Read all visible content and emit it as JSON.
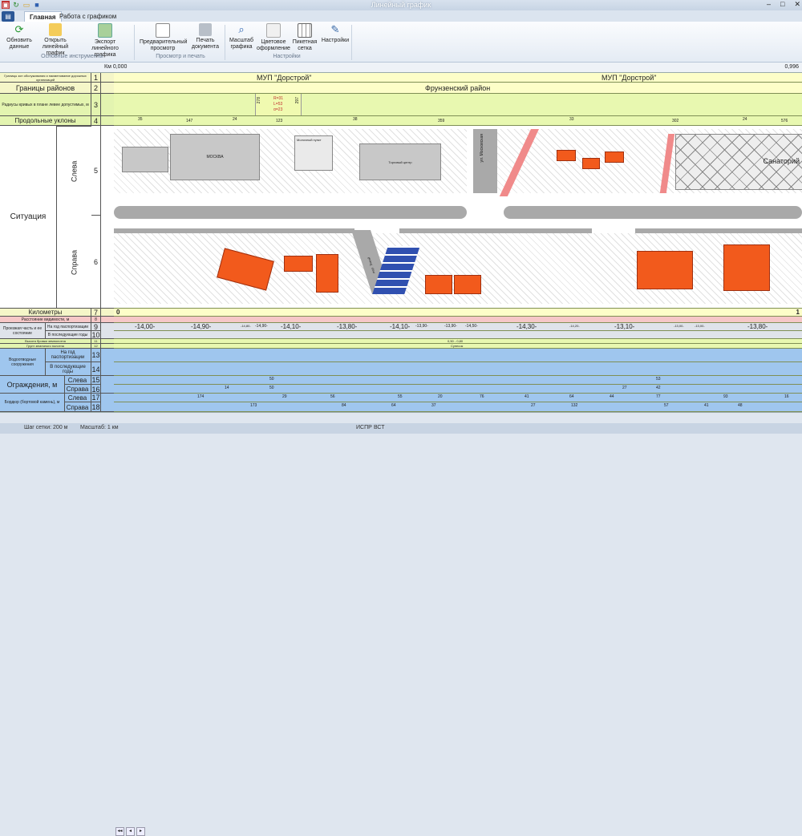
{
  "window": {
    "title": "Линейный график"
  },
  "tabs": [
    {
      "label": "Главная"
    },
    {
      "label": "Работа с графиком"
    }
  ],
  "ribbon": {
    "buttons": [
      {
        "label": "Обновить данные",
        "icon": "refresh-icon"
      },
      {
        "label": "Открыть линейный график",
        "icon": "folder-open-icon"
      },
      {
        "label": "Экспорт линейного графика",
        "icon": "export-icon"
      },
      {
        "label": "Предварительный просмотр",
        "icon": "preview-icon"
      },
      {
        "label": "Печать документа",
        "icon": "printer-icon"
      },
      {
        "label": "Масштаб графика",
        "icon": "zoom-icon"
      },
      {
        "label": "Цветовое оформление",
        "icon": "palette-icon"
      },
      {
        "label": "Пикетная сетка",
        "icon": "grid-icon"
      },
      {
        "label": "Настройки",
        "icon": "settings-icon"
      }
    ],
    "groups": [
      "Основные инструменты",
      "Просмотр и печать",
      "Настройки"
    ]
  },
  "ruler": {
    "start": "Км 0,000",
    "end": "0,996"
  },
  "rows": {
    "r1": {
      "label": "Границы зон обслуживания и наименование дорожных организаций",
      "num": "1"
    },
    "r2": {
      "label": "Границы районов",
      "num": "2"
    },
    "r3": {
      "label": "Радиусы кривых в плане левее допустимых, м",
      "num": "3"
    },
    "r4": {
      "label": "Продольные уклоны",
      "num": "4"
    },
    "situation": {
      "label": "Ситуация"
    },
    "left_side": {
      "label": "Слева",
      "num": "5"
    },
    "right_side": {
      "label": "Справа",
      "num": "6"
    },
    "r7": {
      "label": "Километры",
      "num": "7"
    },
    "r8": {
      "label": "Расстояние видимости, м",
      "num": "8"
    },
    "r9group": {
      "label": "Проезжая часть и ее состояние"
    },
    "r9": {
      "label": "На год паспортизации",
      "num": "9"
    },
    "r10": {
      "label": "В последующие годы",
      "num": "10"
    },
    "r11": {
      "label": "Высота бровки земполотна",
      "num": "11"
    },
    "r12": {
      "label": "Грунт земляного полотна",
      "num": "12"
    },
    "drain": {
      "label": "Водоотводные сооружения"
    },
    "r13": {
      "label": "На год паспортизации",
      "num": "13"
    },
    "r14": {
      "label": "В последующие годы",
      "num": "14"
    },
    "fences": {
      "label": "Ограждения, м"
    },
    "r15": {
      "label": "Слева",
      "num": "15"
    },
    "r16": {
      "label": "Справа",
      "num": "16"
    },
    "curb": {
      "label": "Бордюр (бортовой камень), м"
    },
    "r17": {
      "label": "Слева",
      "num": "17"
    },
    "r18": {
      "label": "Справа",
      "num": "18"
    }
  },
  "graph": {
    "orgs": [
      "МУП \"Дорстрой\"",
      "МУП \"Дорстрой\""
    ],
    "district": "Фрунзенский район",
    "curve": {
      "r": "R=31",
      "l": "L=53",
      "a": "α=23",
      "left": "278",
      "right": "297"
    },
    "slopes": [
      "35",
      "147",
      "24",
      "123",
      "38",
      "359",
      "33",
      "302",
      "24",
      "576"
    ],
    "buildings": {
      "moscow": "МОСКВА",
      "market": "Торговый центр",
      "kiosk": "Молочный пункт",
      "sanatorium": "Санаторий",
      "street1": "ул. Московская",
      "street2": "пер. Тихий"
    },
    "km": {
      "start": "0",
      "end": "1"
    },
    "pavement": [
      "-14,00-",
      "-14,90-",
      "-14,80-",
      "-14,90-",
      "-14,10-",
      "-13,80-",
      "-14,10-",
      "-13,90-",
      "-13,90-",
      "-14,50-",
      "-14,30-",
      "-14,20-",
      "-13,10-",
      "-13,00-",
      "-13,00-",
      "-13,80-"
    ],
    "height": "0,50 - 0,80",
    "soil": "Супесок",
    "fences_left": [
      "50",
      "53"
    ],
    "fences_right": [
      "14",
      "50",
      "27",
      "42"
    ],
    "curb_left": [
      "174",
      "29",
      "56",
      "55",
      "20",
      "76",
      "41",
      "64",
      "44",
      "77",
      "93",
      "16"
    ],
    "curb_right": [
      "173",
      "84",
      "64",
      "37",
      "27",
      "132",
      "57",
      "41",
      "48"
    ]
  },
  "status": {
    "grid": "Шаг сетки: 200 м",
    "scale": "Масштаб: 1 км",
    "mode1": "ИСПР",
    "mode2": "ВСТ"
  },
  "colors": {
    "green": "#e8f8b0",
    "yellow": "#fdfec8",
    "blue": "#9fc6ee",
    "pink": "#f6c7c7",
    "building": "#f25a1c",
    "road": "#a9a9a9"
  }
}
